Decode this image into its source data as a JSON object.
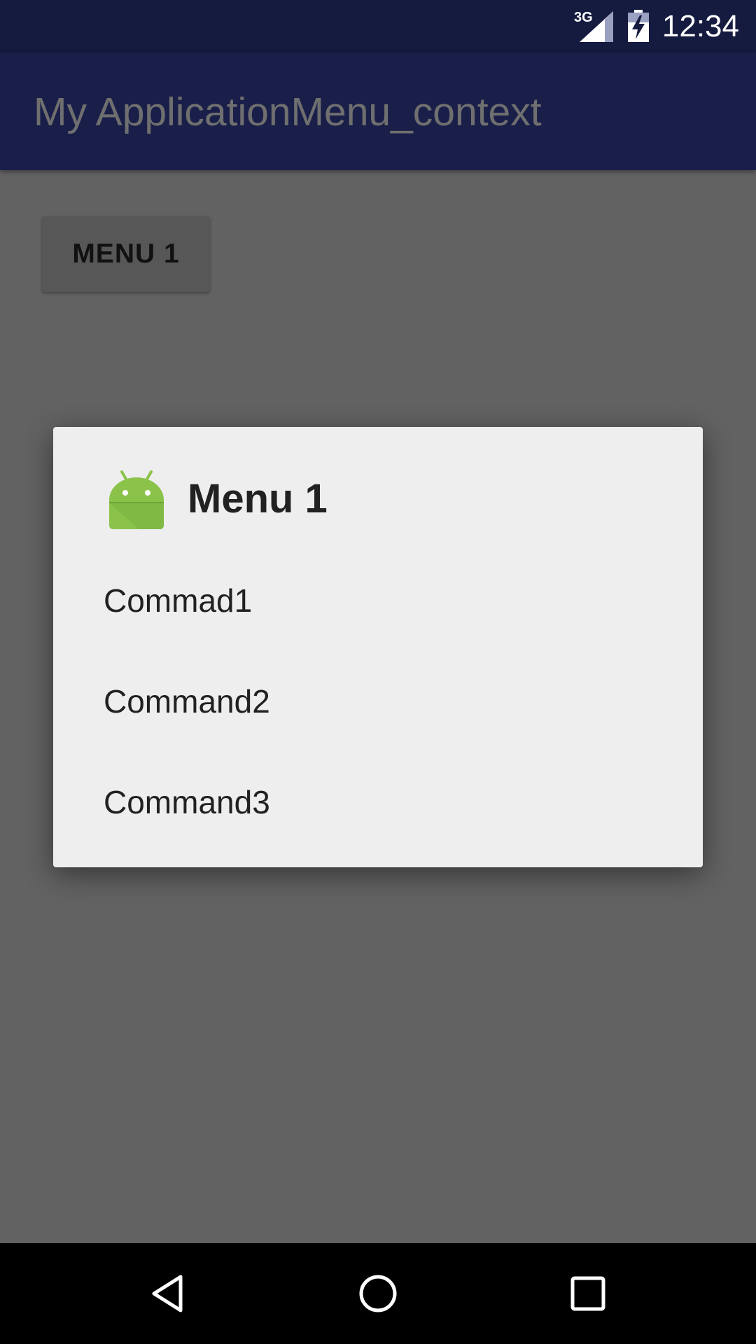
{
  "status_bar": {
    "time": "12:34",
    "network": "3G",
    "icons": [
      "signal-icon",
      "battery-charging-icon"
    ]
  },
  "app_bar": {
    "title": "My ApplicationMenu_context"
  },
  "content": {
    "menu_button_label": "MENU 1"
  },
  "dialog": {
    "icon": "android-robot-icon",
    "title": "Menu 1",
    "items": [
      {
        "label": "Commad1"
      },
      {
        "label": "Command2"
      },
      {
        "label": "Command3"
      }
    ]
  },
  "nav_bar": {
    "icons": [
      "back-icon",
      "home-icon",
      "recents-icon"
    ]
  },
  "colors": {
    "status_bar": "#151a3f",
    "app_bar": "#1a1f4a",
    "scrim_background": "#626262",
    "dialog_background": "#eeeeee",
    "android_green": "#8bc34a"
  }
}
